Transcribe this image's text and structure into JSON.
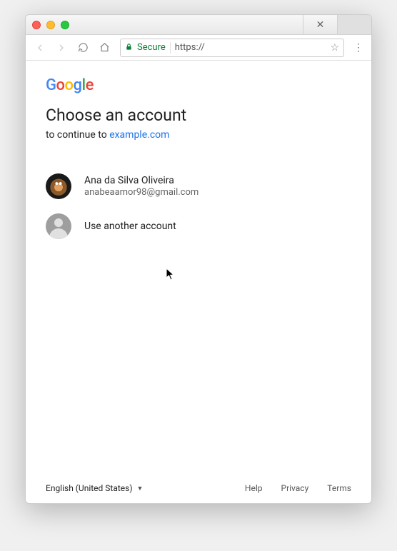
{
  "window": {
    "tab_close_glyph": "✕"
  },
  "toolbar": {
    "secure_label": "Secure",
    "url_prefix": "https://"
  },
  "logo": {
    "g1": "G",
    "o1": "o",
    "o2": "o",
    "g2": "g",
    "l": "l",
    "e": "e"
  },
  "heading": "Choose an account",
  "subheading_prefix": "to continue to ",
  "subheading_link": "example.com",
  "accounts": [
    {
      "name": "Ana da Silva Oliveira",
      "email": "anabeaamor98@gmail.com"
    }
  ],
  "use_another_label": "Use another account",
  "footer": {
    "language": "English (United States)",
    "help": "Help",
    "privacy": "Privacy",
    "terms": "Terms"
  }
}
